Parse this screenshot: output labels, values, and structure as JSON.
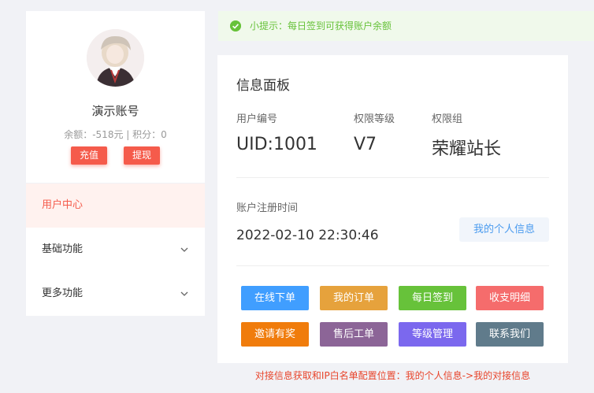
{
  "profile": {
    "username": "演示账号",
    "balance_line": "余额：-518元 | 积分：0",
    "recharge_label": "充值",
    "withdraw_label": "提现"
  },
  "nav": {
    "items": [
      {
        "label": "用户中心",
        "active": true
      },
      {
        "label": "基础功能"
      },
      {
        "label": "更多功能"
      }
    ]
  },
  "tip": {
    "text": "小提示：每日签到可获得账户余额"
  },
  "panel": {
    "title": "信息面板",
    "stats": [
      {
        "label": "用户编号",
        "value": "UID:1001"
      },
      {
        "label": "权限等级",
        "value": "V7"
      },
      {
        "label": "权限组",
        "value": "荣耀站长"
      }
    ],
    "reg_label": "账户注册时间",
    "reg_value": "2022-02-10 22:30:46",
    "info_button": "我的个人信息",
    "buttons": [
      {
        "label": "在线下单",
        "color": "#409eff"
      },
      {
        "label": "我的订单",
        "color": "#e6a23c"
      },
      {
        "label": "每日签到",
        "color": "#67c23a"
      },
      {
        "label": "收支明细",
        "color": "#f56c6c"
      },
      {
        "label": "邀请有奖",
        "color": "#f07c0c"
      },
      {
        "label": "售后工单",
        "color": "#8c6597"
      },
      {
        "label": "等级管理",
        "color": "#7b68ee"
      },
      {
        "label": "联系我们",
        "color": "#607b8b"
      }
    ]
  },
  "footer_note": "对接信息获取和IP白名单配置位置：我的个人信息->我的对接信息"
}
